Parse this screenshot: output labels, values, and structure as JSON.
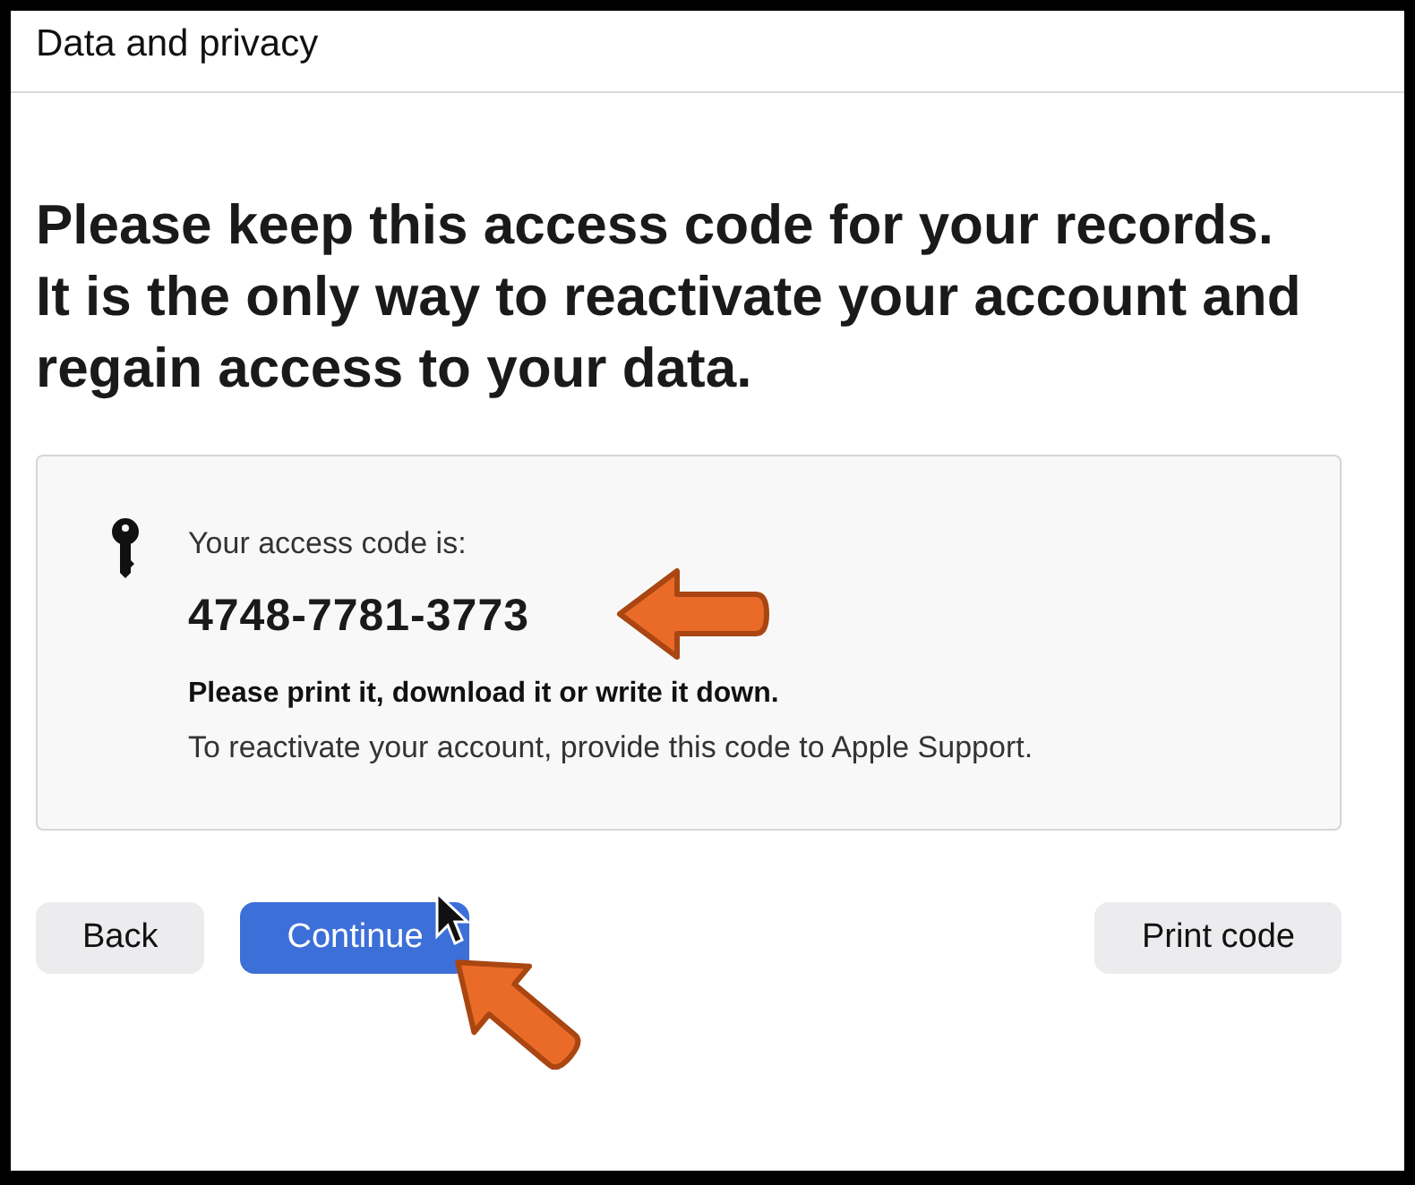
{
  "header": {
    "title": "Data and privacy"
  },
  "heading": "Please keep this access code for your records. It is the only way to reactivate your account and regain access to your data.",
  "code_card": {
    "label": "Your access code is:",
    "code": "4748-7781-3773",
    "instruction": "Please print it, download it or write it down.",
    "note": "To reactivate your account, provide this code to Apple Support."
  },
  "buttons": [
    {
      "label": "Back",
      "kind": "secondary"
    },
    {
      "label": "Continue",
      "kind": "primary"
    },
    {
      "label": "Print code",
      "kind": "secondary"
    }
  ]
}
